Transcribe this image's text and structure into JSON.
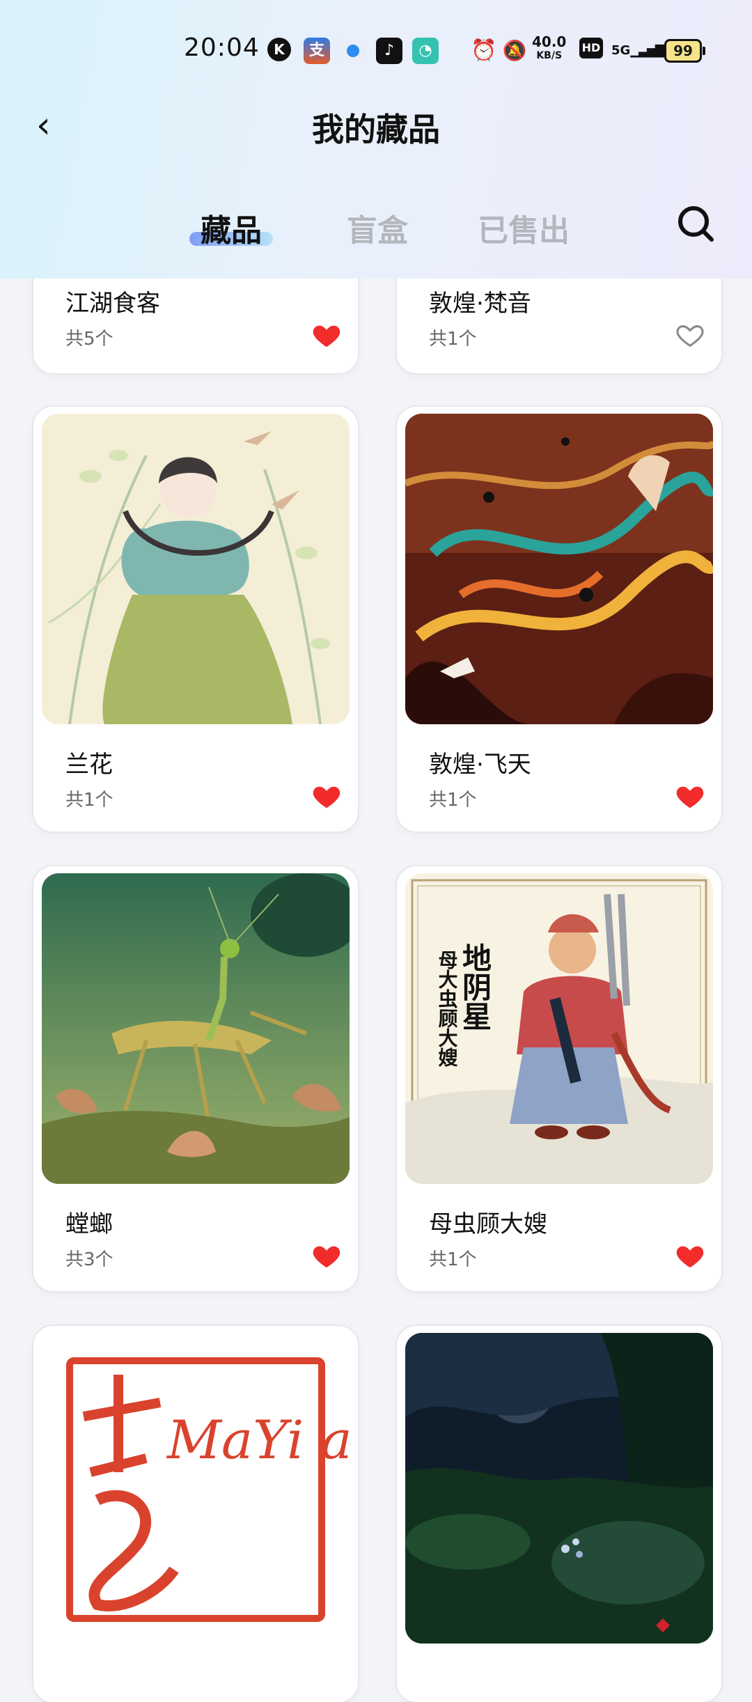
{
  "status": {
    "time": "20:04",
    "net_speed_value": "40.0",
    "net_speed_unit": "KB/S",
    "hd": "HD",
    "signal": "5G",
    "battery": "99"
  },
  "header": {
    "title": "我的藏品"
  },
  "tabs": [
    {
      "label": "藏品",
      "active": true
    },
    {
      "label": "盲盒",
      "active": false
    },
    {
      "label": "已售出",
      "active": false
    }
  ],
  "items": [
    {
      "name": "江湖食客",
      "count": "共5个",
      "liked": true
    },
    {
      "name": "敦煌·梵音",
      "count": "共1个",
      "liked": false
    },
    {
      "name": "兰花",
      "count": "共1个",
      "liked": true
    },
    {
      "name": "敦煌·飞天",
      "count": "共1个",
      "liked": true
    },
    {
      "name": "螳螂",
      "count": "共3个",
      "liked": true
    },
    {
      "name": "母虫顾大嫂",
      "count": "共1个",
      "liked": true
    },
    {
      "name": "",
      "count": "",
      "liked": null
    },
    {
      "name": "",
      "count": "",
      "liked": null
    }
  ],
  "artwork_text": {
    "dibaxing": "地阴星",
    "mochong": "母大虫顾大嫂",
    "mayi_logo": "MaYi art"
  },
  "colors": {
    "heart_red": "#f22b2b",
    "heart_outline": "#8a8a8a"
  }
}
